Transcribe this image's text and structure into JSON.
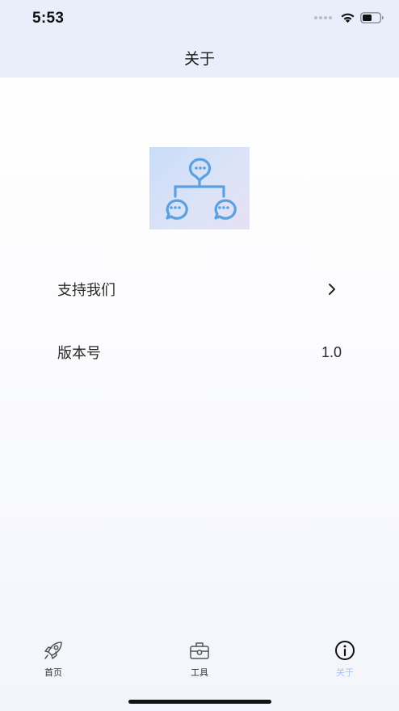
{
  "status_bar": {
    "time": "5:53"
  },
  "nav": {
    "title": "关于"
  },
  "logo": {
    "icon": "chat-hierarchy-icon",
    "accent_color": "#5ba0e0"
  },
  "rows": [
    {
      "label": "支持我们",
      "trailing": "chevron-right-icon"
    },
    {
      "label": "版本号",
      "value": "1.0"
    }
  ],
  "tabbar": {
    "active_color": "#a7c4ef",
    "items": [
      {
        "label": "首页",
        "icon": "rocket-icon"
      },
      {
        "label": "工具",
        "icon": "toolbox-icon"
      },
      {
        "label": "关于",
        "icon": "info-icon",
        "active": true
      }
    ]
  }
}
